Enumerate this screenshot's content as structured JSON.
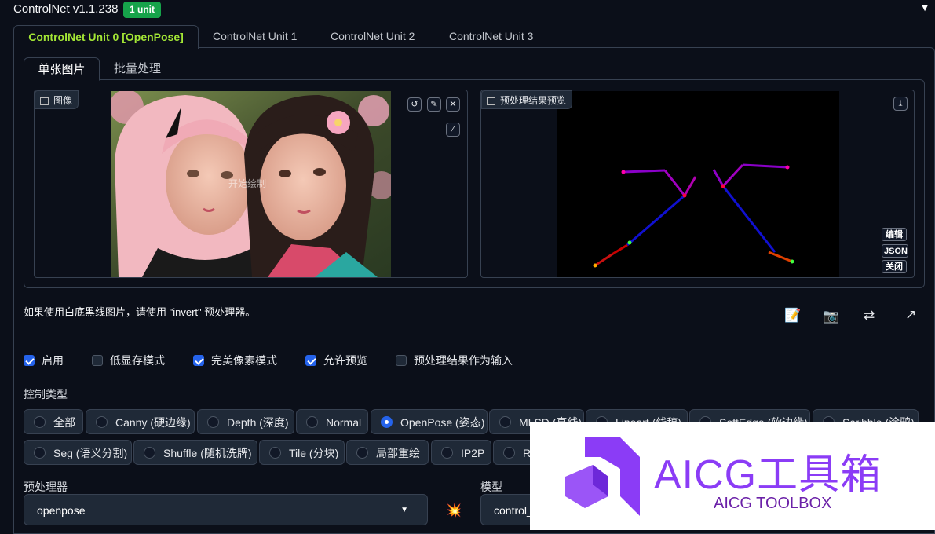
{
  "header": {
    "title": "ControlNet v1.1.238",
    "badge": "1 unit",
    "collapse_glyph": "▼"
  },
  "unit_tabs": [
    {
      "label": "ControlNet Unit 0 [OpenPose]"
    },
    {
      "label": "ControlNet Unit 1"
    },
    {
      "label": "ControlNet Unit 2"
    },
    {
      "label": "ControlNet Unit 3"
    }
  ],
  "sub_tabs": [
    {
      "label": "单张图片"
    },
    {
      "label": "批量处理"
    }
  ],
  "image_panel": {
    "label": "图像",
    "watermark": "开始绘制",
    "tools": [
      "↺",
      "✎",
      "✕",
      "⁄"
    ]
  },
  "preview_panel": {
    "label": "预处理结果预览",
    "download_glyph": "⤓",
    "side_buttons": [
      "编辑",
      "JSON",
      "关闭"
    ]
  },
  "hint": "如果使用白底黑线图片，请使用 \"invert\" 预处理器。",
  "action_icons": [
    "📝",
    "📷",
    "⇄",
    "↗"
  ],
  "checkboxes": [
    {
      "label": "启用",
      "checked": true
    },
    {
      "label": "低显存模式",
      "checked": false
    },
    {
      "label": "完美像素模式",
      "checked": true
    },
    {
      "label": "允许预览",
      "checked": true
    },
    {
      "label": "预处理结果作为输入",
      "checked": false
    }
  ],
  "control_type": {
    "label": "控制类型",
    "row1": [
      "全部",
      "Canny (硬边缘)",
      "Depth (深度)",
      "Normal",
      "OpenPose (姿态)",
      "MLSD (直线)",
      "Lineart (线稿)",
      "SoftEdge (软边缘)",
      "Scribble (涂鸦)"
    ],
    "row2": [
      "Seg (语义分割)",
      "Shuffle (随机洗牌)",
      "Tile (分块)",
      "局部重绘",
      "IP2P",
      "Re"
    ],
    "selected": "OpenPose (姿态)"
  },
  "preprocessor": {
    "label": "预处理器",
    "value": "openpose",
    "run_icon": "💥"
  },
  "model": {
    "label": "模型",
    "value": "control_"
  },
  "watermark": {
    "title": "AICG工具箱",
    "subtitle": "AICG TOOLBOX",
    "color": "#8b3cf6"
  }
}
